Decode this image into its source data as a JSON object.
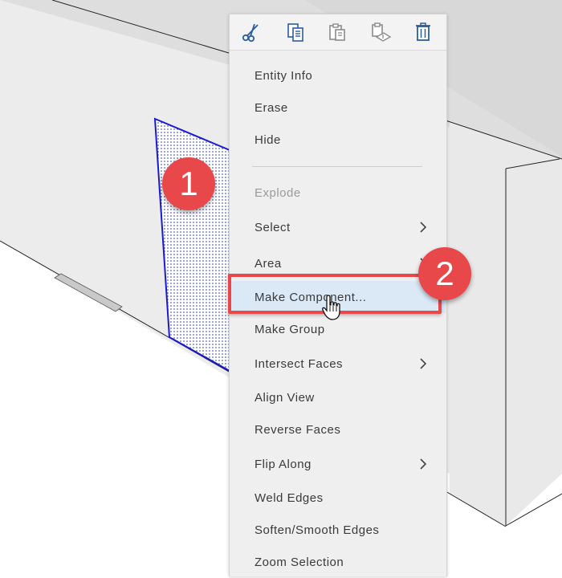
{
  "toolbar": {
    "buttons": [
      {
        "name": "cut",
        "icon": "scissors-icon"
      },
      {
        "name": "copy",
        "icon": "copy-icon"
      },
      {
        "name": "paste",
        "icon": "paste-icon"
      },
      {
        "name": "paste-in-place",
        "icon": "paste-in-place-icon"
      },
      {
        "name": "delete",
        "icon": "trash-icon"
      }
    ]
  },
  "menu": {
    "items": [
      {
        "label": "Entity Info",
        "disabled": false,
        "submenu": false
      },
      {
        "label": "Erase",
        "disabled": false,
        "submenu": false
      },
      {
        "label": "Hide",
        "disabled": false,
        "submenu": false
      },
      {
        "label": "Explode",
        "disabled": true,
        "submenu": false
      },
      {
        "label": "Select",
        "disabled": false,
        "submenu": true
      },
      {
        "label": "Area",
        "disabled": false,
        "submenu": true
      },
      {
        "label": "Make Component...",
        "disabled": false,
        "submenu": false,
        "highlighted": true
      },
      {
        "label": "Make Group",
        "disabled": false,
        "submenu": false
      },
      {
        "label": "Intersect Faces",
        "disabled": false,
        "submenu": true
      },
      {
        "label": "Align View",
        "disabled": false,
        "submenu": false
      },
      {
        "label": "Reverse Faces",
        "disabled": false,
        "submenu": false
      },
      {
        "label": "Flip Along",
        "disabled": false,
        "submenu": true
      },
      {
        "label": "Weld Edges",
        "disabled": false,
        "submenu": false
      },
      {
        "label": "Soften/Smooth Edges",
        "disabled": false,
        "submenu": false
      },
      {
        "label": "Zoom Selection",
        "disabled": false,
        "submenu": false
      }
    ]
  },
  "callouts": {
    "step1": "1",
    "step2": "2"
  },
  "colors": {
    "accent_red": "#e8484a",
    "icon_blue": "#2b5d9b",
    "selection_blue": "#1a1ad0",
    "highlight_bg": "#dbe9f7"
  }
}
